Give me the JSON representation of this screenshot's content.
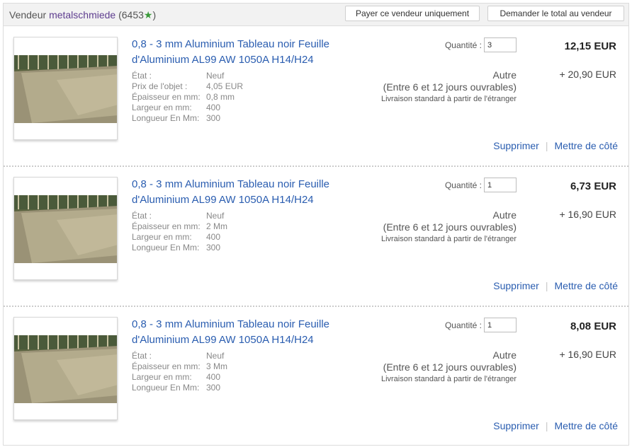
{
  "seller": {
    "prefix": "Vendeur",
    "name": "metalschmiede",
    "feedback_open": "(6453",
    "star": "★",
    "feedback_close": ")",
    "pay_button": "Payer ce vendeur uniquement",
    "total_button": "Demander le total au vendeur"
  },
  "items": [
    {
      "title": "0,8 - 3 mm Aluminium Tableau noir Feuille d'Aluminium AL99 AW 1050A H14/H24",
      "specs": [
        {
          "label": "État :",
          "value": "Neuf"
        },
        {
          "label": "Prix de l'objet :",
          "value": "4,05 EUR"
        },
        {
          "label": "Épaisseur en mm:",
          "value": "0,8 mm"
        },
        {
          "label": "Largeur en mm:",
          "value": "400"
        },
        {
          "label": "Longueur En Mm:",
          "value": "300"
        }
      ],
      "qty_label": "Quantité :",
      "qty": "3",
      "price": "12,15 EUR",
      "shipping": "+ 20,90 EUR",
      "ship_method": "Autre",
      "ship_delay": "(Entre 6 et 12 jours ouvrables)",
      "ship_note": "Livraison standard à partir de l'étranger",
      "remove": "Supprimer",
      "save": "Mettre de côté"
    },
    {
      "title": "0,8 - 3 mm Aluminium Tableau noir Feuille d'Aluminium AL99 AW 1050A H14/H24",
      "specs": [
        {
          "label": "État :",
          "value": "Neuf"
        },
        {
          "label": "Épaisseur en mm:",
          "value": "2 Mm"
        },
        {
          "label": "Largeur en mm:",
          "value": "400"
        },
        {
          "label": "Longueur En Mm:",
          "value": "300"
        }
      ],
      "qty_label": "Quantité :",
      "qty": "1",
      "price": "6,73 EUR",
      "shipping": "+ 16,90 EUR",
      "ship_method": "Autre",
      "ship_delay": "(Entre 6 et 12 jours ouvrables)",
      "ship_note": "Livraison standard à partir de l'étranger",
      "remove": "Supprimer",
      "save": "Mettre de côté"
    },
    {
      "title": "0,8 - 3 mm Aluminium Tableau noir Feuille d'Aluminium AL99 AW 1050A H14/H24",
      "specs": [
        {
          "label": "État :",
          "value": "Neuf"
        },
        {
          "label": "Épaisseur en mm:",
          "value": "3 Mm"
        },
        {
          "label": "Largeur en mm:",
          "value": "400"
        },
        {
          "label": "Longueur En Mm:",
          "value": "300"
        }
      ],
      "qty_label": "Quantité :",
      "qty": "1",
      "price": "8,08 EUR",
      "shipping": "+ 16,90 EUR",
      "ship_method": "Autre",
      "ship_delay": "(Entre 6 et 12 jours ouvrables)",
      "ship_note": "Livraison standard à partir de l'étranger",
      "remove": "Supprimer",
      "save": "Mettre de côté"
    }
  ]
}
